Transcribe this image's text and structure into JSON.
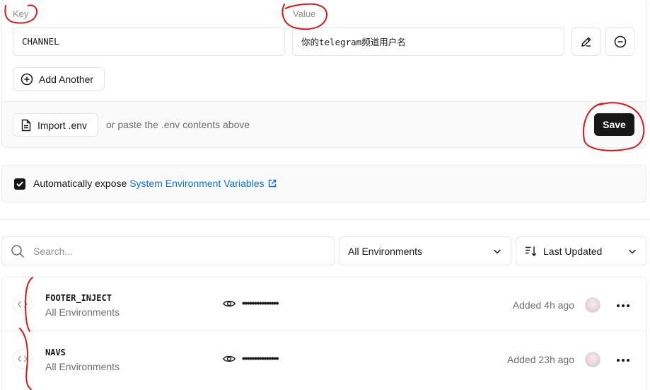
{
  "editor": {
    "key_label": "Key",
    "value_label": "Value",
    "key_value": "CHANNEL",
    "value_value": "你的telegram频道用户名",
    "add_another_label": "Add Another",
    "import_label": "Import .env",
    "paste_hint": "or paste the .env contents above",
    "save_label": "Save"
  },
  "expose": {
    "checked": true,
    "text": "Automatically expose",
    "link_text": "System Environment Variables"
  },
  "filters": {
    "search_placeholder": "Search...",
    "environment_selected": "All Environments",
    "sort_selected": "Last Updated"
  },
  "variables": [
    {
      "name": "FOOTER_INJECT",
      "environments": "All Environments",
      "masked_value": "•••••••••••••••",
      "added": "Added 4h ago"
    },
    {
      "name": "NAVS",
      "environments": "All Environments",
      "masked_value": "•••••••••••••••",
      "added": "Added 23h ago"
    }
  ],
  "colors": {
    "accent_link": "#0a72ef",
    "primary_button": "#171717",
    "annotation": "#d7191c"
  },
  "icons": [
    "edit-icon",
    "remove-icon",
    "plus-circle-icon",
    "file-icon",
    "external-link-icon",
    "check-icon",
    "search-icon",
    "chevron-down-icon",
    "sort-icon",
    "code-icon",
    "eye-icon",
    "more-icon"
  ]
}
